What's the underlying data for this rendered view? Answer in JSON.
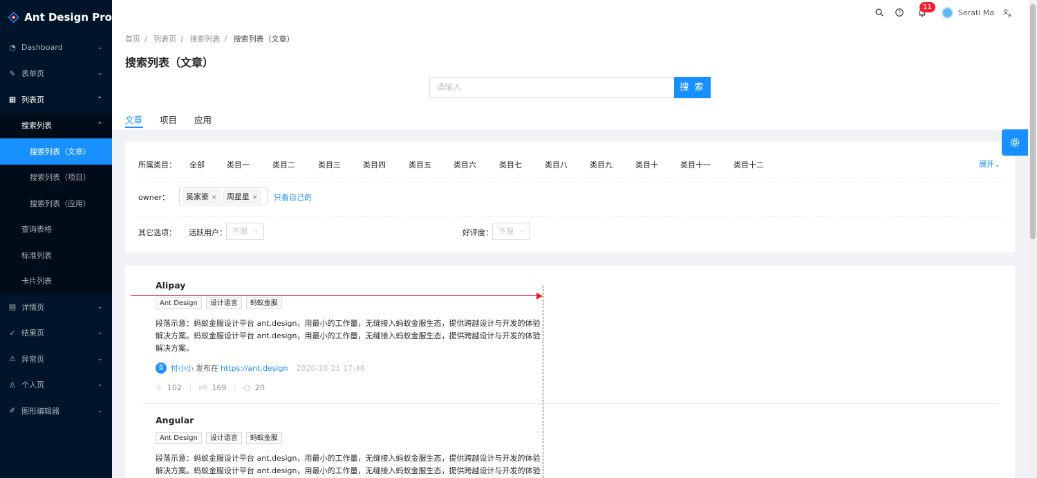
{
  "app": {
    "title": "Ant Design Pro"
  },
  "sidebar": {
    "items": [
      {
        "label": "Dashboard",
        "icon": "dashboard-icon"
      },
      {
        "label": "表单页",
        "icon": "form-icon"
      },
      {
        "label": "列表页",
        "icon": "table-icon"
      },
      {
        "label": "搜索列表"
      },
      {
        "label": "搜索列表（文章）"
      },
      {
        "label": "搜索列表（项目）"
      },
      {
        "label": "搜索列表（应用）"
      },
      {
        "label": "查询表格"
      },
      {
        "label": "标准列表"
      },
      {
        "label": "卡片列表"
      },
      {
        "label": "详情页",
        "icon": "profile-icon"
      },
      {
        "label": "结果页",
        "icon": "check-circle-icon"
      },
      {
        "label": "异常页",
        "icon": "warning-icon"
      },
      {
        "label": "个人页",
        "icon": "user-icon"
      },
      {
        "label": "图形编辑器",
        "icon": "highlight-icon"
      }
    ]
  },
  "header": {
    "notification_count": "11",
    "user_name": "Serati Ma"
  },
  "breadcrumb": [
    "首页",
    "列表页",
    "搜索列表",
    "搜索列表（文章）"
  ],
  "page": {
    "title": "搜索列表（文章）",
    "search_placeholder": "请输入",
    "search_button": "搜 索",
    "tabs": [
      "文章",
      "项目",
      "应用"
    ]
  },
  "filters": {
    "category_label": "所属类目：",
    "categories": [
      "全部",
      "类目一",
      "类目二",
      "类目三",
      "类目四",
      "类目五",
      "类目六",
      "类目七",
      "类目八",
      "类目九",
      "类目十",
      "类目十一",
      "类目十二"
    ],
    "expand_label": "展开",
    "owner_label": "owner：",
    "owners": [
      "吴家豪",
      "周星星"
    ],
    "only_mine": "只看自己的",
    "other_label": "其它选项：",
    "active_user_label": "活跃用户：",
    "active_user_value": "不限",
    "rating_label": "好评度：",
    "rating_value": "不限"
  },
  "articles": [
    {
      "title": "Alipay",
      "tags": [
        "Ant Design",
        "设计语言",
        "蚂蚁金服"
      ],
      "description": "段落示意：蚂蚁金服设计平台 ant.design，用最小的工作量，无缝接入蚂蚁金服生态，提供跨越设计与开发的体验解决方案。蚂蚁金服设计平台 ant.design，用最小的工作量，无缝接入蚂蚁金服生态，提供跨越设计与开发的体验解决方案。",
      "author": "付小小",
      "published_text": "发布在",
      "link": "https://ant.design",
      "time": "2020-10-21 17:48",
      "stars": "102",
      "likes": "169",
      "comments": "20"
    },
    {
      "title": "Angular",
      "tags": [
        "Ant Design",
        "设计语言",
        "蚂蚁金服"
      ],
      "description": "段落示意：蚂蚁金服设计平台 ant.design，用最小的工作量，无缝接入蚂蚁金服生态，提供跨越设计与开发的体验解决方案。蚂蚁金服设计平台 ant.design，用最小的工作量，无缝接入蚂蚁金服生态，提供跨越设计与开发的体验解决方案。"
    }
  ],
  "colors": {
    "primary": "#1890ff",
    "sider": "#001529",
    "annotation": "#e02020"
  }
}
